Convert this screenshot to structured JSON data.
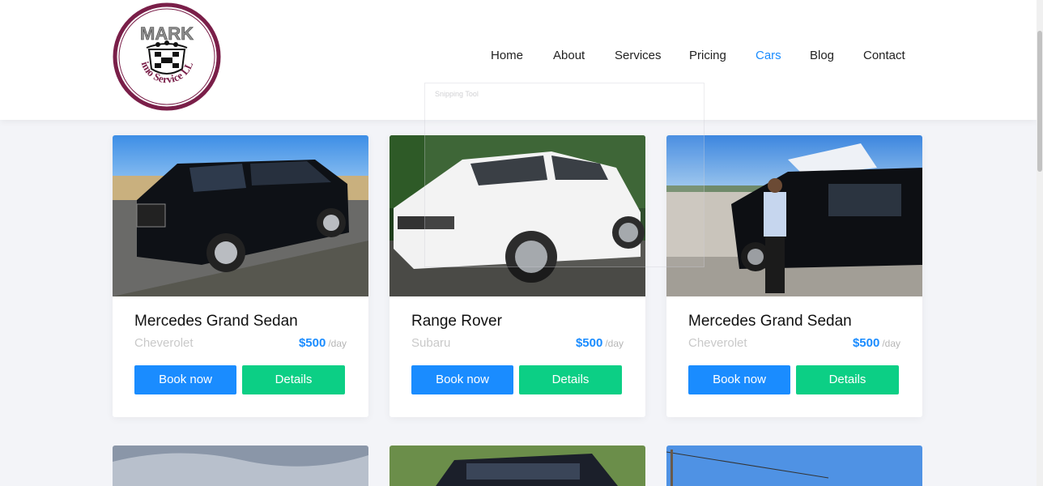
{
  "header": {
    "logo": {
      "name": "MARK",
      "subtitle": "Limo Service LLC"
    },
    "nav": [
      {
        "label": "Home",
        "active": false
      },
      {
        "label": "About",
        "active": false
      },
      {
        "label": "Services",
        "active": false
      },
      {
        "label": "Pricing",
        "active": false
      },
      {
        "label": "Cars",
        "active": true
      },
      {
        "label": "Blog",
        "active": false
      },
      {
        "label": "Contact",
        "active": false
      }
    ]
  },
  "overlay": {
    "label": "Snipping Tool"
  },
  "cars": [
    {
      "title": "Mercedes Grand Sedan",
      "brand": "Cheverolet",
      "price": "$500",
      "per": "/day",
      "book_label": "Book now",
      "details_label": "Details"
    },
    {
      "title": "Range Rover",
      "brand": "Subaru",
      "price": "$500",
      "per": "/day",
      "book_label": "Book now",
      "details_label": "Details"
    },
    {
      "title": "Mercedes Grand Sedan",
      "brand": "Cheverolet",
      "price": "$500",
      "per": "/day",
      "book_label": "Book now",
      "details_label": "Details"
    }
  ],
  "colors": {
    "accent": "#1a8cff",
    "details_button": "#0ccf85",
    "active_nav": "#1a8cff"
  }
}
